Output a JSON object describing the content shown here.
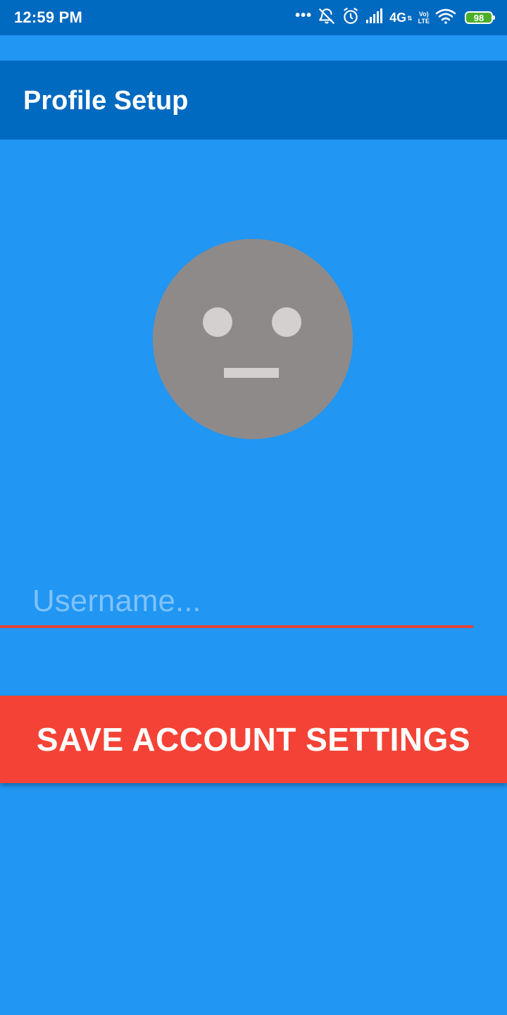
{
  "status_bar": {
    "time": "12:59 PM",
    "dots": "•••",
    "network": "4G",
    "network_arrows": "⇅",
    "volte_top": "Vo)",
    "volte_bottom": "LTE",
    "battery": "98",
    "icons": [
      "more-dots-icon",
      "notifications-off-icon",
      "alarm-icon",
      "signal-icon",
      "volte-icon",
      "wifi-icon",
      "battery-icon"
    ]
  },
  "app_bar": {
    "title": "Profile Setup"
  },
  "avatar": {
    "icon": "neutral-face-avatar-icon"
  },
  "username": {
    "value": "",
    "placeholder": "Username..."
  },
  "save_button": {
    "label": "SAVE ACCOUNT SETTINGS"
  },
  "colors": {
    "background": "#2196F3",
    "app_bar": "#0069C0",
    "avatar": "#8E8A89",
    "avatar_features": "#D3D0CF",
    "accent": "#F44336",
    "underline": "#E0453A",
    "battery": "#4CAF2A"
  }
}
